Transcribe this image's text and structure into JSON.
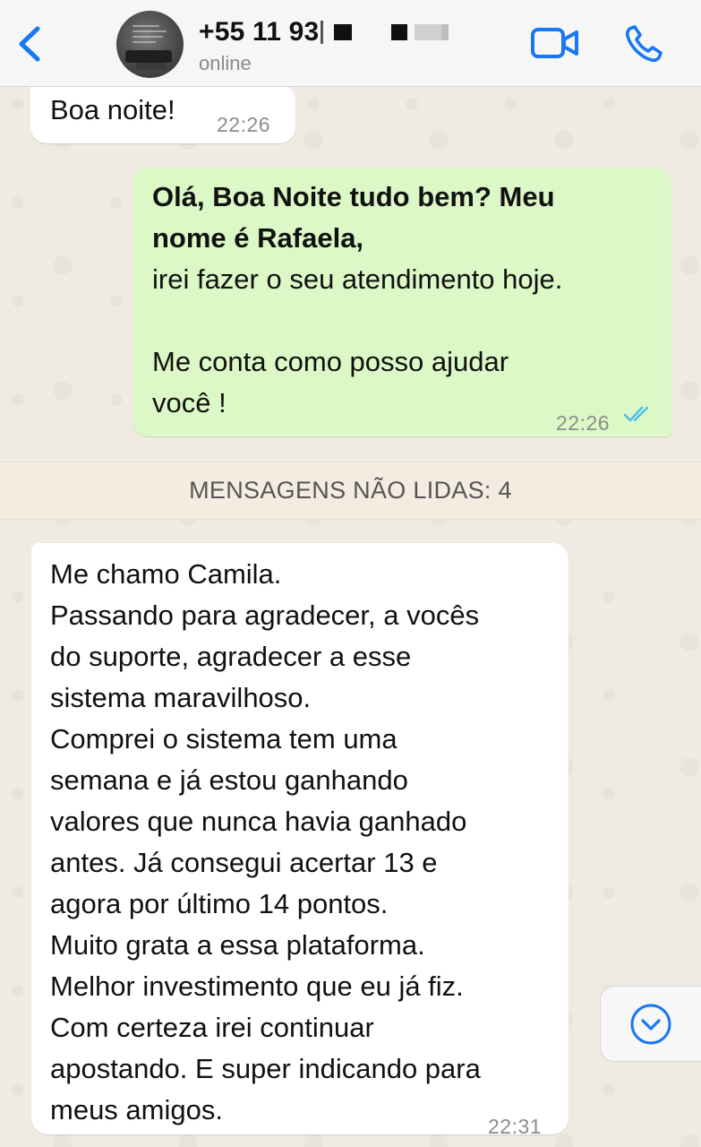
{
  "header": {
    "contact_name": "+55 11 93",
    "status": "online"
  },
  "messages": [
    {
      "direction": "incoming",
      "text": "Boa noite!",
      "time": "22:26"
    },
    {
      "direction": "outgoing",
      "bold_lines": [
        "Olá, Boa Noite tudo bem? Meu",
        "nome é Rafaela,"
      ],
      "lines": [
        "irei fazer o seu atendimento hoje.",
        "",
        "Me conta como posso ajudar",
        "você !"
      ],
      "time": "22:26",
      "read": true
    },
    {
      "direction": "incoming",
      "lines": [
        "Me chamo Camila.",
        "Passando para agradecer, a vocês",
        "do suporte, agradecer a esse",
        "sistema maravilhoso.",
        "Comprei o sistema tem uma",
        "semana e já estou ganhando",
        "valores que nunca havia ganhado",
        "antes.  Já consegui acertar 13 e",
        "agora por último 14 pontos.",
        "Muito grata a essa plataforma.",
        "Melhor investimento que eu já fiz.",
        "Com certeza irei continuar",
        "apostando. E super indicando para",
        "meus amigos."
      ],
      "time": "22:31"
    }
  ],
  "unread_banner": "MENSAGENS NÃO LIDAS: 4",
  "colors": {
    "accent": "#1877f2",
    "outgoing_bubble": "#dcf8c6",
    "incoming_bubble": "#ffffff",
    "read_ticks": "#53bdeb"
  },
  "icons": [
    "chevron-left-icon",
    "video-camera-icon",
    "phone-icon",
    "double-check-icon",
    "chevron-down-circle-icon"
  ]
}
